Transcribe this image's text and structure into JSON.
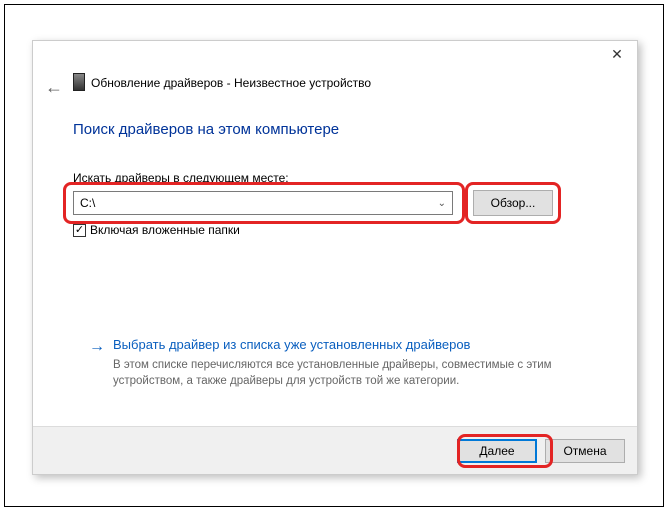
{
  "header": {
    "window_title": "Обновление драйверов - Неизвестное устройство",
    "close_glyph": "✕"
  },
  "main": {
    "heading": "Поиск драйверов на этом компьютере",
    "search_label": "Искать драйверы в следующем месте:",
    "path_value": "C:\\",
    "browse_label": "Обзор...",
    "include_subfolders_label": "Включая вложенные папки",
    "include_subfolders_checked": "✓"
  },
  "pick": {
    "arrow_glyph": "→",
    "title": "Выбрать драйвер из списка уже установленных драйверов",
    "desc": "В этом списке перечисляются все установленные драйверы, совместимые с этим устройством, а также драйверы для устройств той же категории."
  },
  "footer": {
    "next_label": "Далее",
    "cancel_label": "Отмена"
  }
}
